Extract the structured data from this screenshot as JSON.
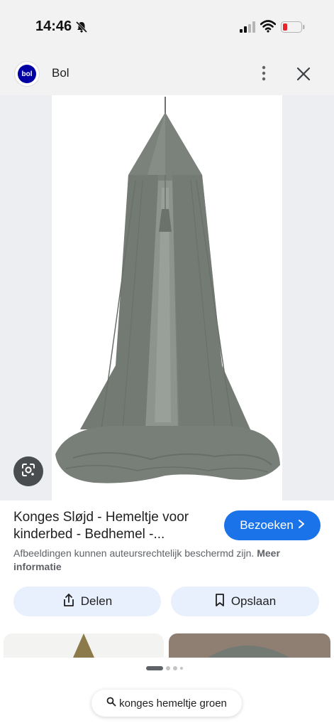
{
  "status_bar": {
    "time": "14:46",
    "icons": [
      "bell-slash-icon",
      "cellular-signal-icon",
      "wifi-icon",
      "battery-low-icon"
    ],
    "battery_color": "#e5252a"
  },
  "header": {
    "logo_text": "bol",
    "site_name": "Bol",
    "icons": [
      "more-vertical-icon",
      "close-icon"
    ],
    "brand_color": "#0000a4"
  },
  "image": {
    "subject": "grey-green canopy",
    "lens_icon": "google-lens-icon"
  },
  "product": {
    "title": "Konges Sløjd - Hemeltje voor kinderbed - Bedhemel -...",
    "visit_label": "Bezoeken",
    "visit_color": "#1a73e8",
    "copyright_text": "Afbeeldingen kunnen auteursrechtelijk beschermd zijn.",
    "more_info_label": "Meer informatie"
  },
  "actions": {
    "share_label": "Delen",
    "save_label": "Opslaan"
  },
  "pagination": {
    "current": 1,
    "total": 4
  },
  "search": {
    "query": "konges hemeltje groen",
    "icon": "search-icon"
  }
}
